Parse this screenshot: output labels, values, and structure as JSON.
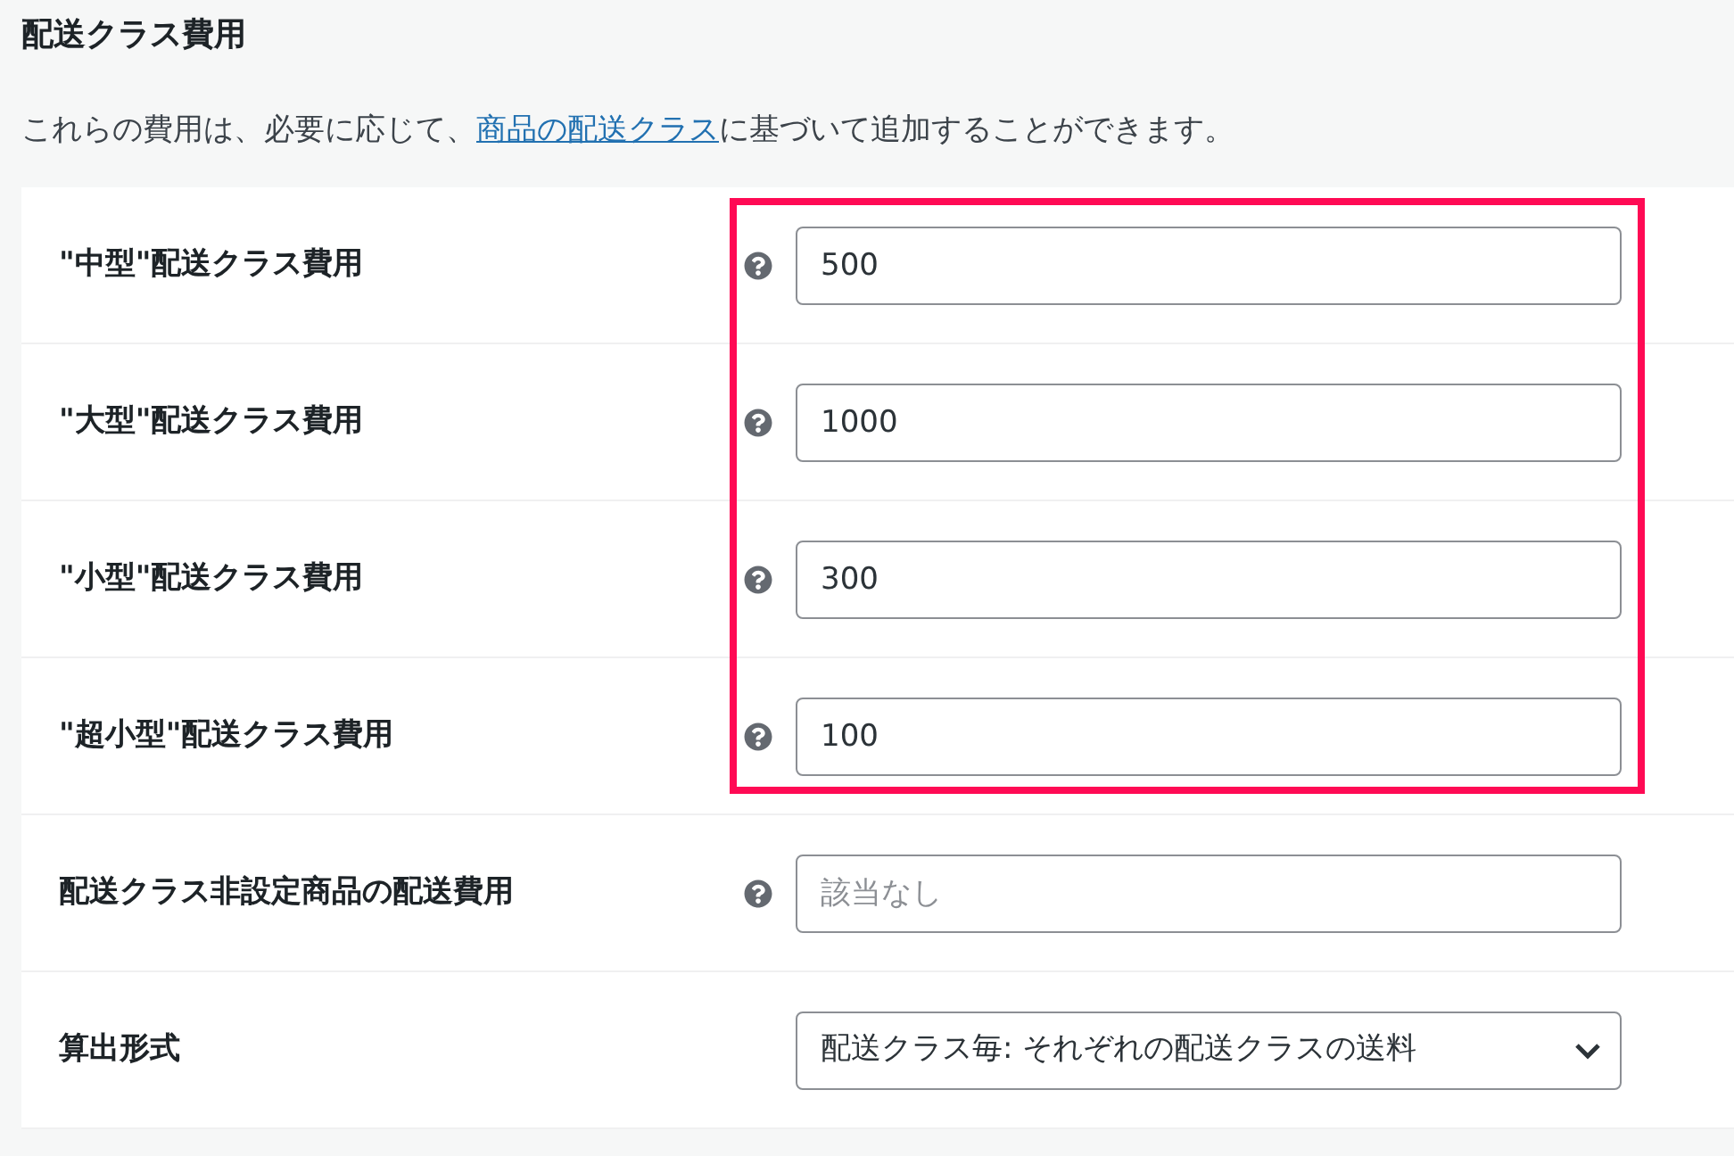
{
  "title": "配送クラス費用",
  "description": {
    "before": "これらの費用は、必要に応じて、",
    "link": "商品の配送クラス",
    "after": "に基づいて追加することができます。"
  },
  "highlighted_rows": [
    {
      "kind": "input",
      "label": "\"中型\"配送クラス費用",
      "help": true,
      "value": "500"
    },
    {
      "kind": "input",
      "label": "\"大型\"配送クラス費用",
      "help": true,
      "value": "1000"
    },
    {
      "kind": "input",
      "label": "\"小型\"配送クラス費用",
      "help": true,
      "value": "300"
    },
    {
      "kind": "input",
      "label": "\"超小型\"配送クラス費用",
      "help": true,
      "value": "100"
    }
  ],
  "rows": [
    {
      "kind": "input",
      "label": "配送クラス非設定商品の配送費用",
      "help": true,
      "placeholder": "該当なし"
    },
    {
      "kind": "select",
      "label": "算出形式",
      "help": false,
      "value": "配送クラス毎: それぞれの配送クラスの送料"
    }
  ]
}
